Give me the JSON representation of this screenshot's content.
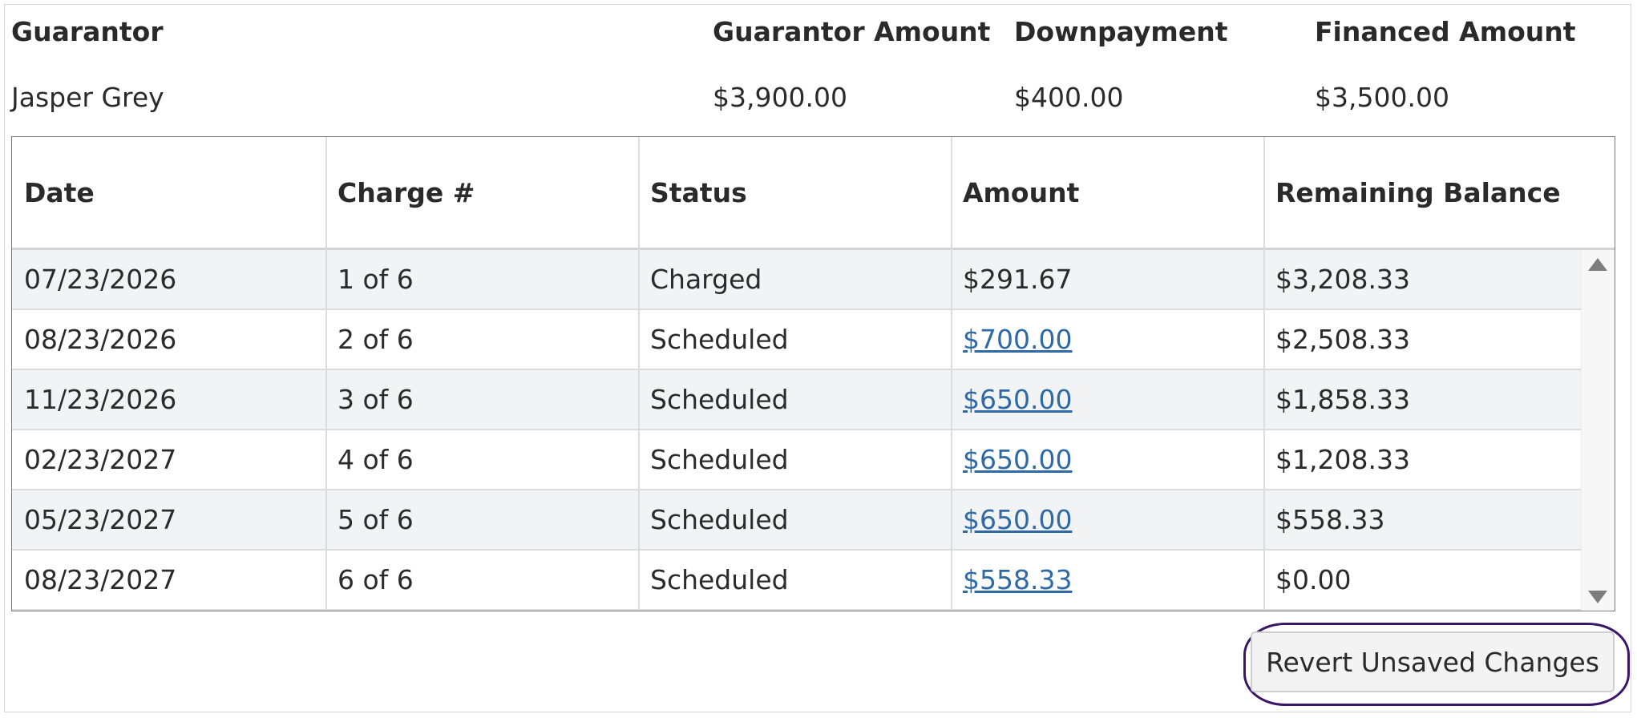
{
  "summary": {
    "headers": {
      "guarantor": "Guarantor",
      "guarantor_amount": "Guarantor Amount",
      "downpayment": "Downpayment",
      "financed_amount": "Financed Amount"
    },
    "values": {
      "guarantor": "Jasper Grey",
      "guarantor_amount": "$3,900.00",
      "downpayment": "$400.00",
      "financed_amount": "$3,500.00"
    }
  },
  "table": {
    "columns": [
      "Date",
      "Charge #",
      "Status",
      "Amount",
      "Remaining Balance"
    ],
    "rows": [
      {
        "date": "07/23/2026",
        "charge": "1 of 6",
        "status": "Charged",
        "amount": "$291.67",
        "amount_link": false,
        "remaining": "$3,208.33"
      },
      {
        "date": "08/23/2026",
        "charge": "2 of 6",
        "status": "Scheduled",
        "amount": "$700.00",
        "amount_link": true,
        "remaining": "$2,508.33"
      },
      {
        "date": "11/23/2026",
        "charge": "3 of 6",
        "status": "Scheduled",
        "amount": "$650.00",
        "amount_link": true,
        "remaining": "$1,858.33"
      },
      {
        "date": "02/23/2027",
        "charge": "4 of 6",
        "status": "Scheduled",
        "amount": "$650.00",
        "amount_link": true,
        "remaining": "$1,208.33"
      },
      {
        "date": "05/23/2027",
        "charge": "5 of 6",
        "status": "Scheduled",
        "amount": "$650.00",
        "amount_link": true,
        "remaining": "$558.33"
      },
      {
        "date": "08/23/2027",
        "charge": "6 of 6",
        "status": "Scheduled",
        "amount": "$558.33",
        "amount_link": true,
        "remaining": "$0.00"
      }
    ]
  },
  "actions": {
    "revert_label": "Revert Unsaved Changes"
  },
  "colors": {
    "link": "#2f6aa6",
    "highlight_outline": "#3b1566",
    "row_stripe": "#f2f3f4"
  },
  "icons": {
    "scroll_up": "scroll-up-arrow-icon",
    "scroll_down": "scroll-down-arrow-icon"
  }
}
